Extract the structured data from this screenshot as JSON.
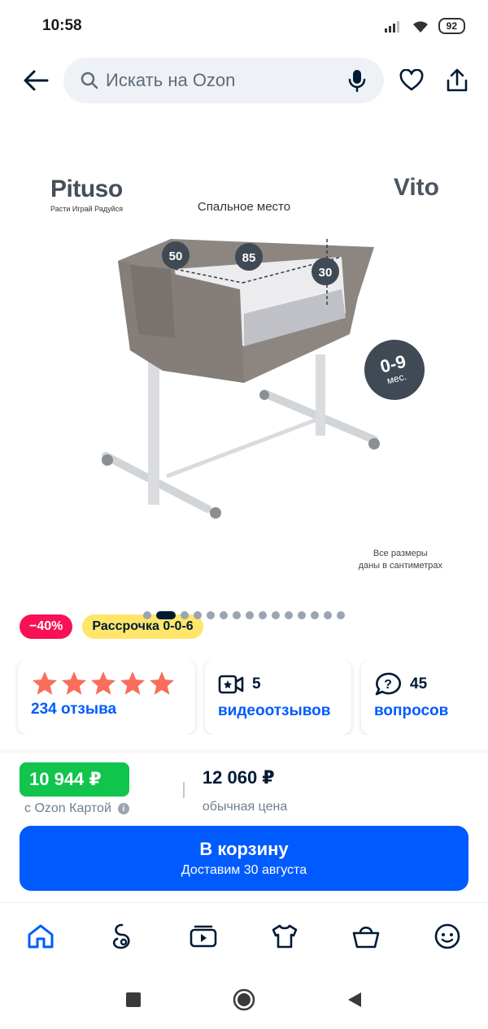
{
  "status": {
    "time": "10:58",
    "battery": "92"
  },
  "search": {
    "placeholder": "Искать на Ozon"
  },
  "product_image": {
    "brand": "Pituso",
    "brand_tagline": "Расти Играй Радуйся",
    "model": "Vito",
    "caption": "Спальное место",
    "dim_width": "50",
    "dim_length": "85",
    "dim_height": "30",
    "age_big": "0-9",
    "age_small": "мес.",
    "note_line1": "Все размеры",
    "note_line2": "даны в сантиметрах",
    "total_images": 15,
    "active_image": 1
  },
  "badges": {
    "discount": "−40%",
    "installment": "Рассрочка 0-0-6"
  },
  "cards": {
    "rating_stars": 5,
    "reviews": "234 отзыва",
    "videos_count": "5",
    "videos_label": "видеоотзывов",
    "questions_count": "45",
    "questions_label": "вопросов"
  },
  "price": {
    "ozon_card": "10 944 ₽",
    "ozon_card_label": "с Ozon Картой",
    "regular": "12 060 ₽",
    "regular_label": "обычная цена"
  },
  "cart": {
    "title": "В корзину",
    "subtitle": "Доставим 30 августа"
  },
  "colors": {
    "accent": "#005bff",
    "green": "#10c44c",
    "discount": "#f91155",
    "installment": "#ffe66b",
    "stars": "#f96d5a"
  }
}
